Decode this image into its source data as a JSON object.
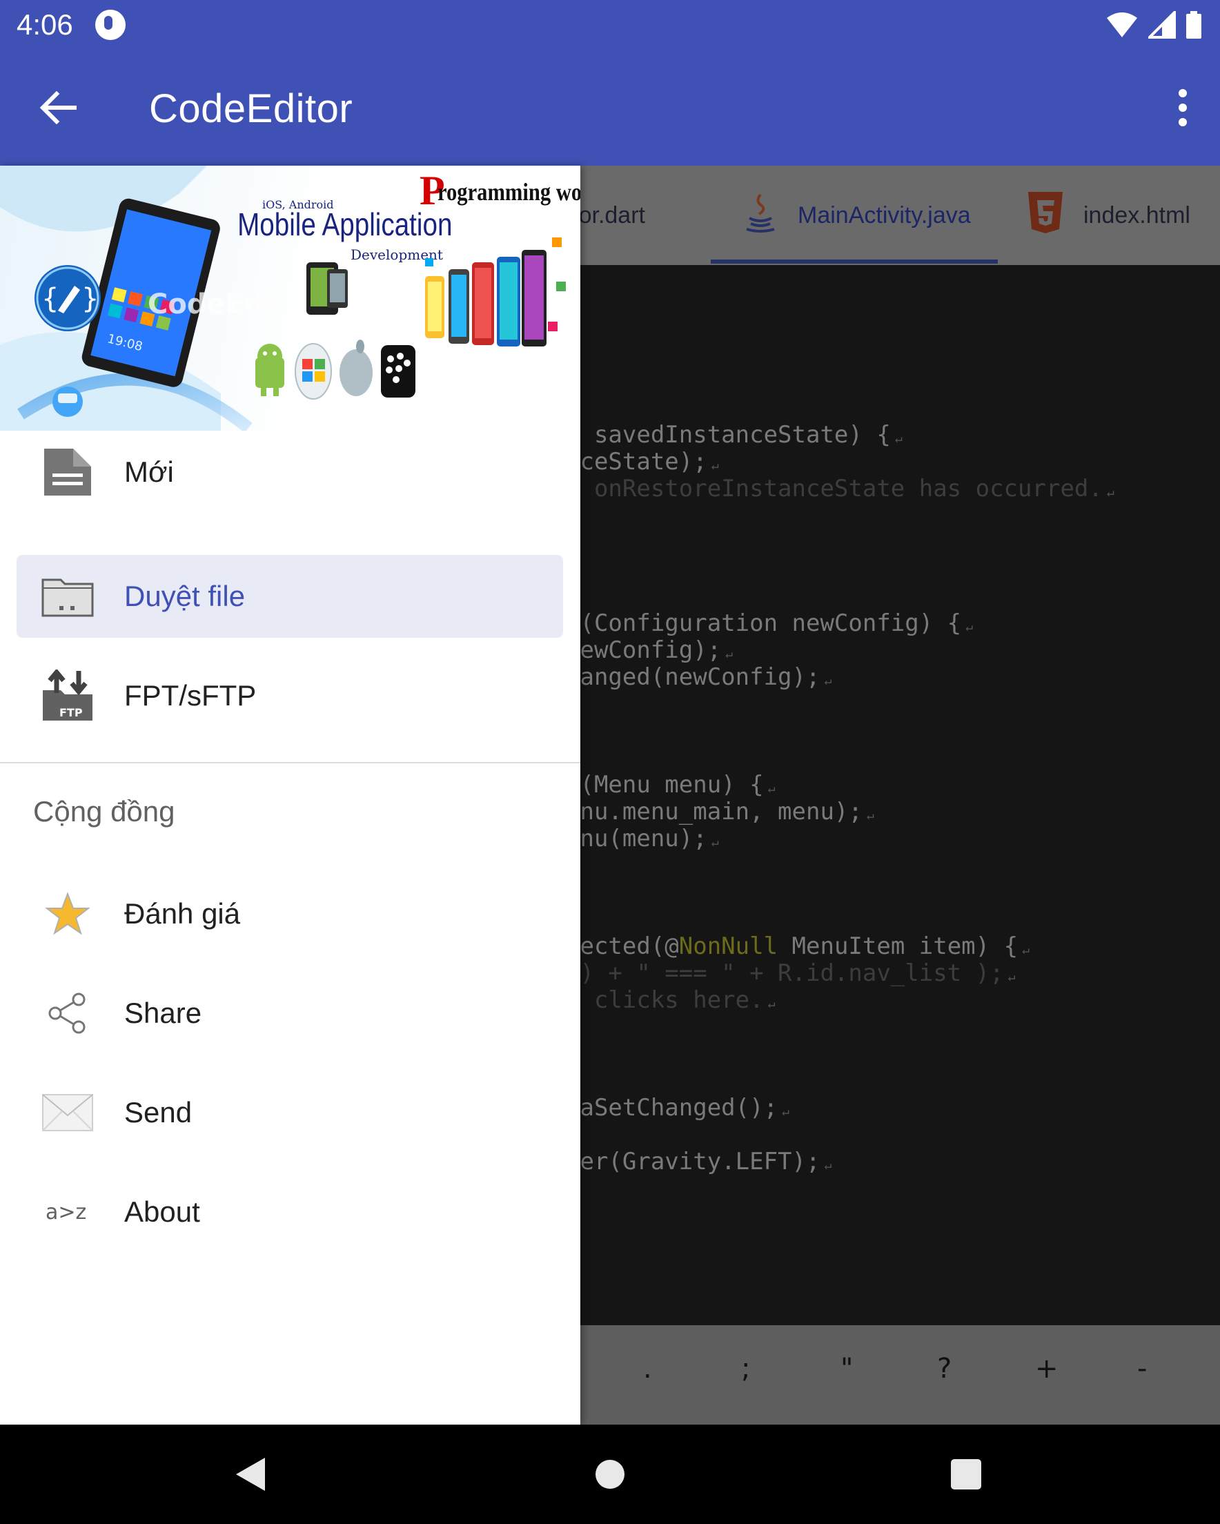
{
  "status_bar": {
    "time": "4:06"
  },
  "app_bar": {
    "title": "CodeEditor"
  },
  "editor": {
    "tabs": [
      {
        "label": "Editor.dart",
        "icon": "dart-file-icon"
      },
      {
        "label": "MainActivity.java",
        "icon": "java-icon",
        "selected": true
      },
      {
        "label": "index.html",
        "icon": "html5-icon"
      }
    ],
    "code_lines": [
      "e savedInstanceState) {",
      "nceState);",
      "r onRestoreInstanceState has occurred.",
      "d(Configuration newConfig) {",
      "newConfig);",
      "hanged(newConfig);",
      "u(Menu menu) {",
      "enu.menu_main, menu);",
      "enu(menu);",
      "lected(@",
      "NonNull",
      " MenuItem item) {",
      "() + \" === \" + R.id.nav_list );",
      "m clicks here.",
      "taSetChanged();",
      "wer(Gravity.LEFT);"
    ],
    "symbols": [
      ".",
      ";",
      "\"",
      "?",
      "+",
      "-"
    ]
  },
  "drawer": {
    "header": {
      "os_label": "iOS, Android",
      "title": "Mobile Application",
      "subtitle": "Development",
      "brand": "rogramming world",
      "brand_initial": "P",
      "watermark": "CodeEdi",
      "clock": "19:08"
    },
    "items": [
      {
        "label": "Mới",
        "icon": "document-icon"
      },
      {
        "label": "Duyệt file",
        "icon": "folder-icon",
        "selected": true
      },
      {
        "label": "FPT/sFTP",
        "icon": "ftp-icon",
        "icon_text": "FTP"
      }
    ],
    "section_title": "Cộng đồng",
    "community": [
      {
        "label": "Đánh giá",
        "icon": "star-icon"
      },
      {
        "label": "Share",
        "icon": "share-icon"
      },
      {
        "label": "Send",
        "icon": "envelope-icon"
      },
      {
        "label": "About",
        "icon": "about-icon",
        "icon_text": "a>z"
      }
    ]
  },
  "colors": {
    "primary": "#3f51b5",
    "selected_bg": "#e8eaf6",
    "star": "#f5b82e"
  }
}
